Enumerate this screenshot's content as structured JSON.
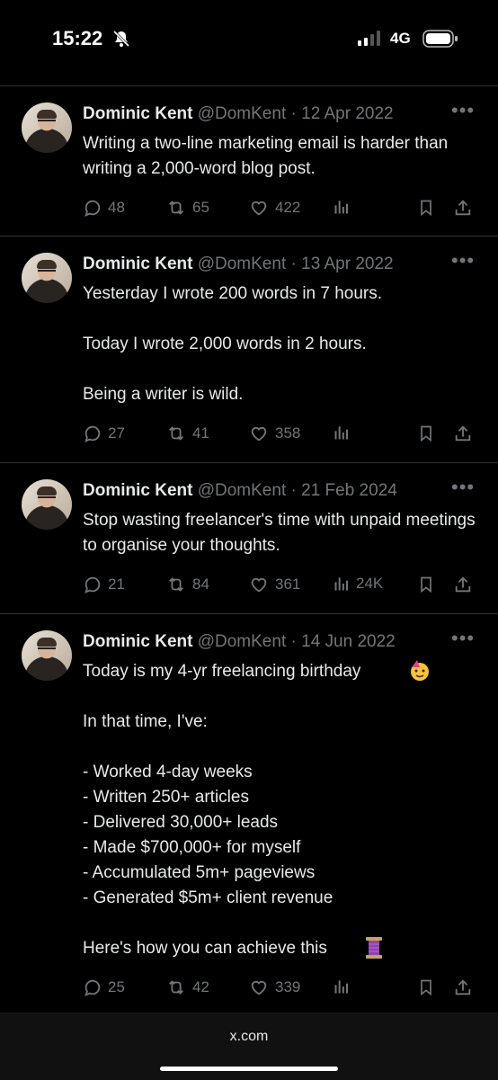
{
  "status_bar": {
    "time": "15:22",
    "network": "4G",
    "icons": [
      "bell-slash-icon",
      "signal-icon",
      "battery-icon"
    ]
  },
  "tweets": [
    {
      "name": "Dominic Kent",
      "handle": "@DomKent",
      "sep": "·",
      "date": "12 Apr 2022",
      "text": "Writing a two-line marketing email is harder than writing a 2,000-word blog post.",
      "replies": "48",
      "reposts": "65",
      "likes": "422",
      "views": ""
    },
    {
      "name": "Dominic Kent",
      "handle": "@DomKent",
      "sep": "·",
      "date": "13 Apr 2022",
      "text": "Yesterday I wrote 200 words in 7 hours.\n\nToday I wrote 2,000 words in 2 hours.\n\nBeing a writer is wild.",
      "replies": "27",
      "reposts": "41",
      "likes": "358",
      "views": ""
    },
    {
      "name": "Dominic Kent",
      "handle": "@DomKent",
      "sep": "·",
      "date": "21 Feb 2024",
      "text": "Stop wasting freelancer's time with unpaid meetings to organise your thoughts.",
      "replies": "21",
      "reposts": "84",
      "likes": "361",
      "views": "24K"
    },
    {
      "name": "Dominic Kent",
      "handle": "@DomKent",
      "sep": "·",
      "date": "14 Jun 2022",
      "text": "Today is my 4-yr freelancing birthday \n\nIn that time, I've:\n\n- Worked 4-day weeks\n- Written 250+ articles\n- Delivered 30,000+ leads\n- Made $700,000+ for myself\n- Accumulated 5m+ pageviews\n- Generated $5m+ client revenue\n\nHere's how you can achieve this ",
      "replies": "25",
      "reposts": "42",
      "likes": "339",
      "views": ""
    }
  ],
  "bottom_bar": {
    "url": "x.com"
  },
  "colors": {
    "background": "#000000",
    "text": "#e7e9ea",
    "muted": "#71767b",
    "divider": "#2f3336"
  }
}
